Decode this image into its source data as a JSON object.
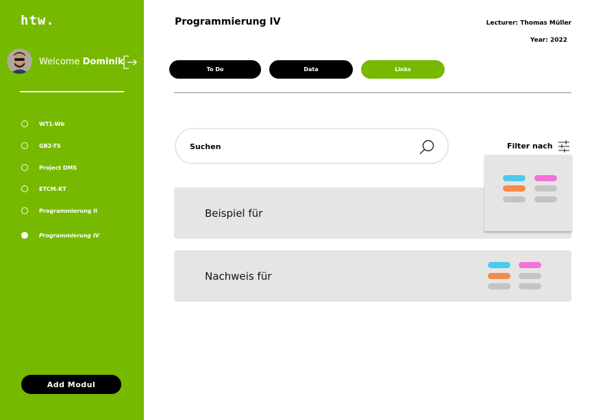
{
  "sidebar": {
    "logo": "htw.",
    "welcome_prefix": "Welcome",
    "user_name": "Dominik",
    "items": [
      {
        "label": "WT1-Wb",
        "active": false
      },
      {
        "label": "GB2-TS",
        "active": false
      },
      {
        "label": "Project DMS",
        "active": false
      },
      {
        "label": "ETCM-KT",
        "active": false
      },
      {
        "label": "Programmierung II",
        "active": false
      },
      {
        "label": "Programmierung IV",
        "active": true
      }
    ],
    "add_button": "Add Modul"
  },
  "header": {
    "title": "Programmierung IV",
    "lecturer": "Lecturer: Thomas Müller",
    "year": "Year: 2022"
  },
  "tabs": [
    {
      "label": "To Do",
      "active": false
    },
    {
      "label": "Data",
      "active": false
    },
    {
      "label": "Links",
      "active": true
    }
  ],
  "search": {
    "label": "Suchen",
    "icon": "search-icon"
  },
  "filter": {
    "label": "Filter nach",
    "icon": "sliders-icon"
  },
  "rows": [
    {
      "label": "Beispiel für"
    },
    {
      "label": "Nachweis für"
    }
  ],
  "colors": {
    "accent": "#76b900",
    "tag_blue": "#4ccaeb",
    "tag_pink": "#f472d8",
    "tag_orange": "#f58a4a",
    "tag_gray": "#c4c4c4"
  }
}
